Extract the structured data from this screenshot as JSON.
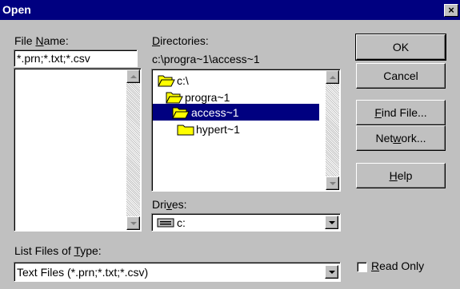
{
  "window": {
    "title": "Open",
    "close_glyph": "×"
  },
  "file_name": {
    "label_pre": "File ",
    "label_u": "N",
    "label_post": "ame:",
    "value": "*.prn;*.txt;*.csv",
    "list_items": []
  },
  "directories": {
    "label_u": "D",
    "label_post": "irectories:",
    "current_path": "c:\\progra~1\\access~1",
    "tree": [
      {
        "label": "c:\\",
        "icon": "open-folder-icon",
        "selected": false
      },
      {
        "label": "progra~1",
        "icon": "open-folder-icon",
        "selected": false
      },
      {
        "label": "access~1",
        "icon": "open-folder-icon",
        "selected": true
      },
      {
        "label": "hypert~1",
        "icon": "folder-icon",
        "selected": false
      }
    ]
  },
  "drives": {
    "label_pre": "Dri",
    "label_u": "v",
    "label_post": "es:",
    "value": "c:",
    "icon": "drive-icon"
  },
  "file_type": {
    "label_pre": "List Files of ",
    "label_u": "T",
    "label_post": "ype:",
    "value": "Text Files (*.prn;*.txt;*.csv)"
  },
  "buttons": {
    "ok": "OK",
    "cancel": "Cancel",
    "find_u": "F",
    "find_post": "ind File...",
    "network_pre": "Net",
    "network_u": "w",
    "network_post": "ork...",
    "help_u": "H",
    "help_post": "elp"
  },
  "read_only": {
    "label_u": "R",
    "label_post": "ead Only",
    "checked": false
  },
  "colors": {
    "title_bar": "#000080",
    "dialog_bg": "#c0c0c0",
    "selection": "#000080",
    "folder": "#ffff00"
  }
}
